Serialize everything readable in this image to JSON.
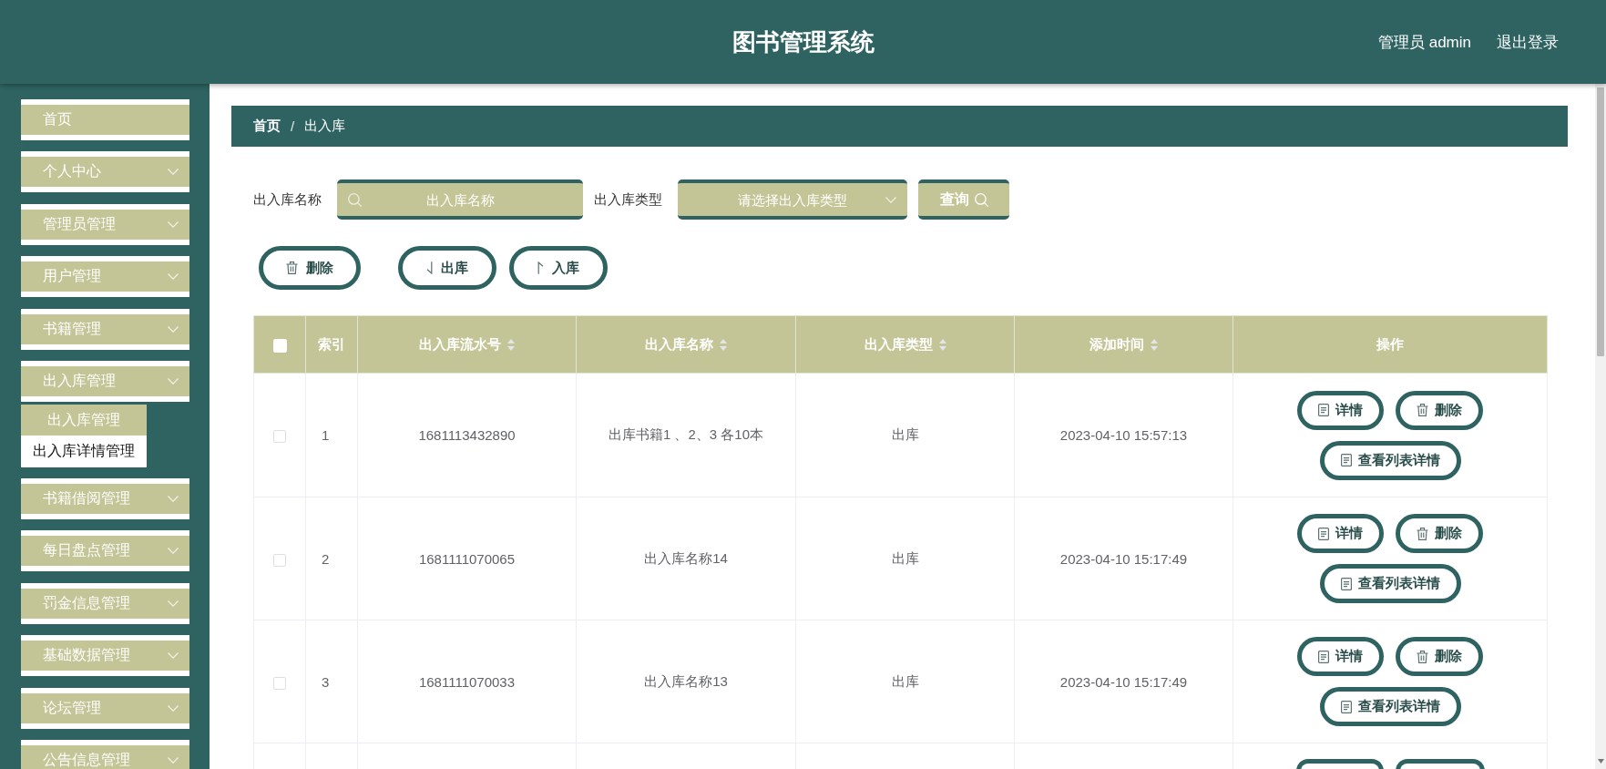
{
  "header": {
    "title": "图书管理系统",
    "user": "管理员 admin",
    "logout": "退出登录"
  },
  "sidebar": {
    "items": [
      {
        "label": "首页",
        "kind": "link"
      },
      {
        "label": "个人中心",
        "kind": "menu"
      },
      {
        "label": "管理员管理",
        "kind": "menu"
      },
      {
        "label": "用户管理",
        "kind": "menu"
      },
      {
        "label": "书籍管理",
        "kind": "menu"
      },
      {
        "label": "出入库管理",
        "kind": "menu",
        "children": [
          {
            "label": "出入库管理",
            "selected": false
          },
          {
            "label": "出入库详情管理",
            "selected": true
          }
        ]
      },
      {
        "label": "书籍借阅管理",
        "kind": "menu"
      },
      {
        "label": "每日盘点管理",
        "kind": "menu"
      },
      {
        "label": "罚金信息管理",
        "kind": "menu"
      },
      {
        "label": "基础数据管理",
        "kind": "menu"
      },
      {
        "label": "论坛管理",
        "kind": "menu"
      },
      {
        "label": "公告信息管理",
        "kind": "menu"
      }
    ]
  },
  "breadcrumb": {
    "items": [
      "首页",
      "出入库"
    ],
    "separator": "/"
  },
  "search": {
    "fields": [
      {
        "label": "出入库名称",
        "kind": "text",
        "placeholder": "出入库名称"
      },
      {
        "label": "出入库类型",
        "kind": "select",
        "placeholder": "请选择出入库类型"
      }
    ],
    "button": "查询"
  },
  "actions": [
    {
      "label": "删除",
      "kind": "delete"
    },
    {
      "label": "出库",
      "kind": "outbound"
    },
    {
      "label": "入库",
      "kind": "inbound"
    }
  ],
  "table": {
    "select_all": {
      "checked": false
    },
    "columns": [
      {
        "label": "索引",
        "sortable": false
      },
      {
        "label": "出入库流水号",
        "sortable": true
      },
      {
        "label": "出入库名称",
        "sortable": true
      },
      {
        "label": "出入库类型",
        "sortable": true
      },
      {
        "label": "添加时间",
        "sortable": true
      },
      {
        "label": "操作",
        "sortable": false
      }
    ],
    "rows": [
      {
        "checked": false,
        "cells": [
          "1",
          "1681113432890",
          "出库书籍1 、2、3 各10本",
          "出库",
          "2023-04-10 15:57:13"
        ],
        "actions": [
          {
            "label": "详情",
            "kind": "detail"
          },
          {
            "label": "删除",
            "kind": "delete"
          },
          {
            "label": "查看列表详情",
            "kind": "detail"
          }
        ]
      },
      {
        "checked": false,
        "cells": [
          "2",
          "1681111070065",
          "出入库名称14",
          "出库",
          "2023-04-10 15:17:49"
        ],
        "actions": [
          {
            "label": "详情",
            "kind": "detail"
          },
          {
            "label": "删除",
            "kind": "delete"
          },
          {
            "label": "查看列表详情",
            "kind": "detail"
          }
        ]
      },
      {
        "checked": false,
        "cells": [
          "3",
          "1681111070033",
          "出入库名称13",
          "出库",
          "2023-04-10 15:17:49"
        ],
        "actions": [
          {
            "label": "详情",
            "kind": "detail"
          },
          {
            "label": "删除",
            "kind": "delete"
          },
          {
            "label": "查看列表详情",
            "kind": "detail"
          }
        ]
      }
    ],
    "more_rows_below": true
  }
}
